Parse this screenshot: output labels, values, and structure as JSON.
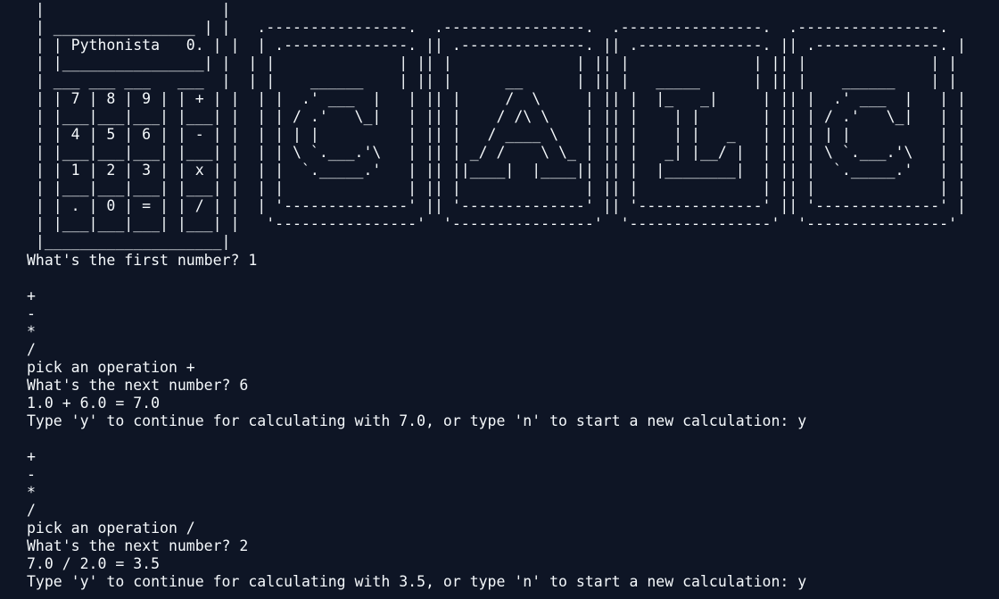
{
  "terminal": {
    "banner": [
      " |                    |",
      " | ________________ | |   .----------------.  .----------------.  .----------------.  .----------------.",
      " | | Pythonista   0. | |  | .--------------. || .--------------. || .--------------. || .--------------. |",
      " | |________________| |  | |              | || |              | || |              | || |              | |",
      " | ___ ___ ___   ___  |  | |    ______    | || |      __      | || |   _____      | || |    ______    | |",
      " | | 7 | 8 | 9 | | + | |  | |  .' ___  |   | || |     /  \\     | || |  |_   _|     | || |  .' ___  |   | |",
      " | |___|___|___| |___| |  | | / .'   \\_|   | || |    / /\\ \\    | || |    | |       | || | / .'   \\_|   | |",
      " | | 4 | 5 | 6 | | - | |  | | | |          | || |   / ____ \\   | || |    | |   _   | || | | |          | |",
      " | |___|___|___| |___| |  | | \\ `.___.'\\   | || | _/ /    \\ \\_ | || |   _| |__/ |  | || | \\ `.___.'\\   | |",
      " | | 1 | 2 | 3 | | x | |  | |  `._____.'   | || ||____|  |____|| || |  |________|  | || |  `._____.'   | |",
      " | |___|___|___| |___| |  | |              | || |              | || |              | || |              | |",
      " | | . | 0 | = | | / | |  | '--------------' || '--------------' || '--------------' || '--------------' |",
      " | |___|___|___| |___| |   '----------------'  '----------------'  '----------------'  '----------------'",
      " |____________________|"
    ],
    "session": [
      "What's the first number? 1",
      "",
      "+",
      "-",
      "*",
      "/",
      "pick an operation +",
      "What's the next number? 6",
      "1.0 + 6.0 = 7.0",
      "Type 'y' to continue for calculating with 7.0, or type 'n' to start a new calculation: y",
      "",
      "+",
      "-",
      "*",
      "/",
      "pick an operation /",
      "What's the next number? 2",
      "7.0 / 2.0 = 3.5",
      "Type 'y' to continue for calculating with 3.5, or type 'n' to start a new calculation: y"
    ]
  }
}
